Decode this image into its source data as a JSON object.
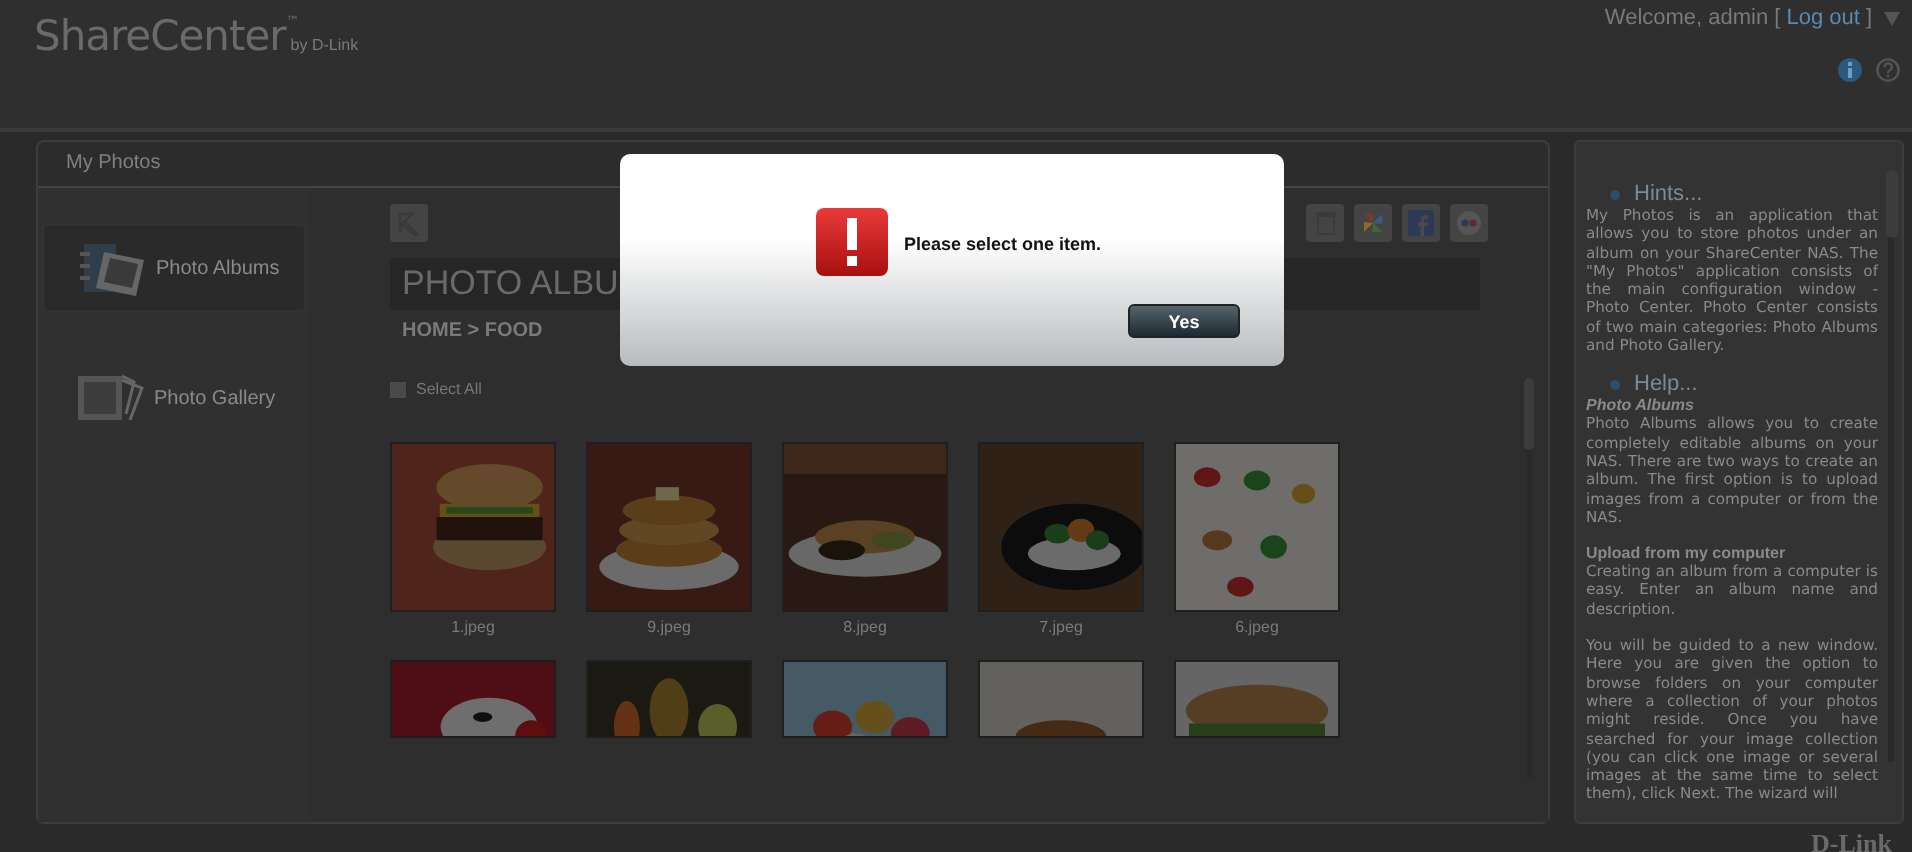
{
  "header": {
    "brand": "ShareCenter$^{™}$",
    "brand_suffix": "by D-Link",
    "welcome": "Welcome, admin [",
    "logout": "Log out",
    "welcome_end": "]"
  },
  "panel": {
    "title": "My Photos"
  },
  "nav": [
    {
      "label": "Photo Albums",
      "selected": true
    },
    {
      "label": "Photo Gallery",
      "selected": false
    }
  ],
  "content": {
    "title": "PHOTO ALBU",
    "breadcrumb": "HOME > FOOD",
    "select_all": {
      "label": "Select All",
      "checked": false
    }
  },
  "photos": [
    {
      "kind": "picture",
      "caption": "1.jpeg"
    },
    {
      "kind": "picture",
      "caption": "9.jpeg"
    },
    {
      "kind": "picture",
      "caption": "8.jpeg"
    },
    {
      "kind": "picture",
      "caption": "7.jpeg"
    },
    {
      "kind": "picture",
      "caption": "6.jpeg"
    },
    {
      "kind": "picture"
    },
    {
      "kind": "picture"
    },
    {
      "kind": "picture"
    },
    {
      "kind": "picture"
    },
    {
      "kind": "picture"
    }
  ],
  "dialog": {
    "message": "Please select one item.",
    "button": "Yes"
  },
  "help": [
    {
      "title": "Hints...",
      "blocks": [
        {
          "kind": "paragraph",
          "text": "My Photos is an application that allows you to store photos under an album on your ShareCenter NAS. The \"My Photos\" application consists of the main configuration window - Photo Center. Photo Center consists of two main categories: Photo Albums and Photo Gallery."
        }
      ]
    },
    {
      "title": "Help...",
      "blocks": [
        {
          "kind": "subtitle",
          "text": "Photo Albums"
        },
        {
          "kind": "paragraph",
          "text": "Photo Albums allows you to create completely editable albums on your NAS. There are two ways to create an album. The first option is to upload images from a computer or from the NAS."
        },
        {
          "kind": "heading",
          "text": "Upload from my computer"
        },
        {
          "kind": "paragraph",
          "text": "Creating an album from a computer is easy. Enter an album name and description."
        },
        {
          "kind": "paragraph",
          "text": "You will be guided to a new window. Here you are given the option to browse folders on your computer where a collection of your photos might reside. Once you have searched for your image collection (you can click one image or several images at the same time to select them), click Next. The wizard will"
        }
      ]
    }
  ],
  "footer": {
    "logo": "D-Link"
  }
}
